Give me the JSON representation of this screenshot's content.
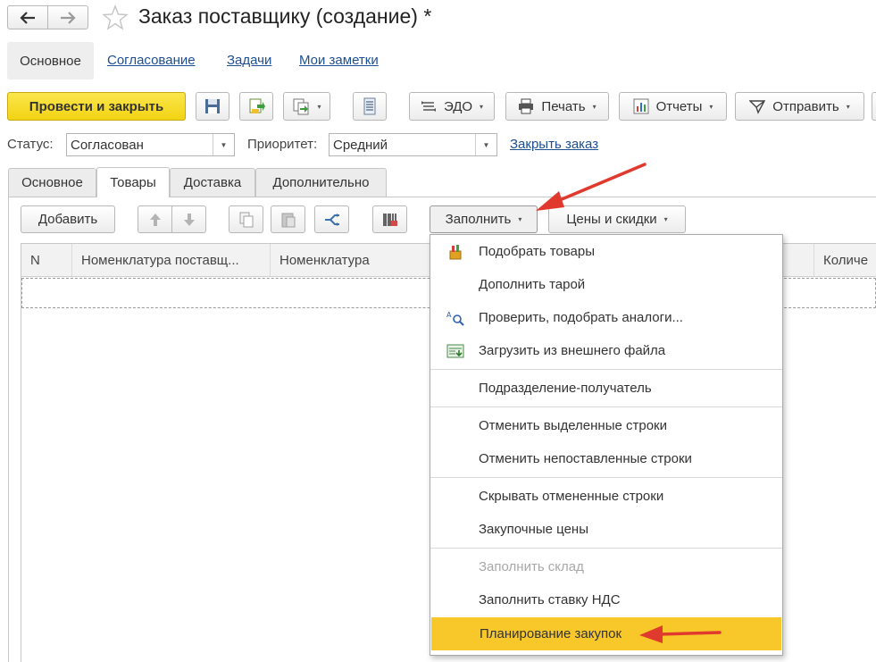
{
  "window": {
    "title": "Заказ поставщику (создание) *"
  },
  "nav_tabs": [
    {
      "label": "Основное",
      "active": true
    },
    {
      "label": "Согласование"
    },
    {
      "label": "Задачи"
    },
    {
      "label": "Мои заметки"
    }
  ],
  "toolbar": {
    "post_close": "Провести и закрыть",
    "edo": "ЭДО",
    "print": "Печать",
    "reports": "Отчеты",
    "send": "Отправить"
  },
  "status_row": {
    "status_label": "Статус:",
    "status_value": "Согласован",
    "priority_label": "Приоритет:",
    "priority_value": "Средний",
    "close_order": "Закрыть заказ"
  },
  "form_tabs": [
    {
      "label": "Основное"
    },
    {
      "label": "Товары",
      "active": true
    },
    {
      "label": "Доставка"
    },
    {
      "label": "Дополнительно"
    }
  ],
  "table_toolbar": {
    "add": "Добавить",
    "fill": "Заполнить",
    "prices": "Цены и скидки"
  },
  "table": {
    "columns": [
      "N",
      "Номенклатура поставщ...",
      "Номенклатура",
      "Количе"
    ]
  },
  "fill_menu": {
    "items": [
      {
        "label": "Подобрать товары",
        "icon": "pick-goods-icon"
      },
      {
        "label": "Дополнить тарой"
      },
      {
        "label": "Проверить, подобрать аналоги...",
        "icon": "analogs-search-icon"
      },
      {
        "label": "Загрузить из внешнего файла",
        "icon": "load-file-icon"
      },
      {
        "label": "Подразделение-получатель"
      },
      {
        "label": "Отменить выделенные строки"
      },
      {
        "label": "Отменить непоставленные строки"
      },
      {
        "label": "Скрывать отмененные строки"
      },
      {
        "label": "Закупочные цены"
      },
      {
        "label": "Заполнить склад",
        "disabled": true
      },
      {
        "label": "Заполнить ставку НДС"
      },
      {
        "label": "Планирование закупок",
        "highlighted": true
      }
    ]
  },
  "colors": {
    "primary_button": "#f5da2b",
    "menu_highlight": "#f8c82a",
    "link": "#1d4f91",
    "annotation_arrow": "#e03a2e"
  }
}
